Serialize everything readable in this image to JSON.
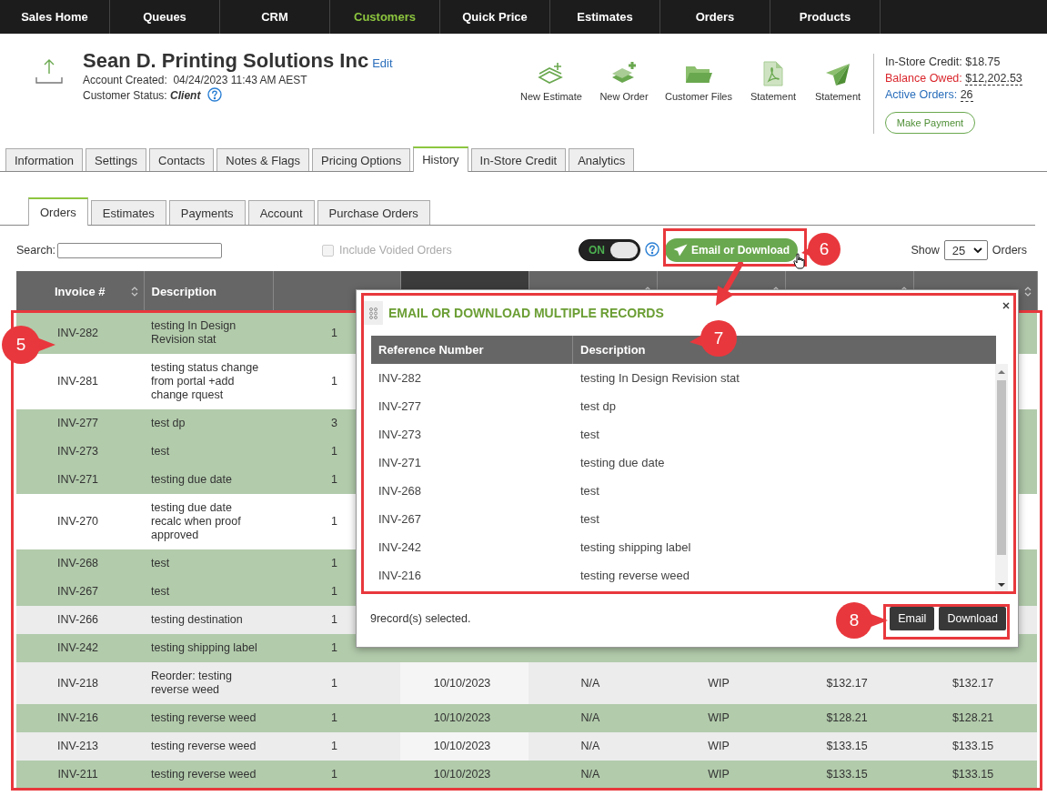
{
  "nav": [
    {
      "label": "Sales Home",
      "selected": false
    },
    {
      "label": "Queues",
      "selected": false
    },
    {
      "label": "CRM",
      "selected": false
    },
    {
      "label": "Customers",
      "selected": true
    },
    {
      "label": "Quick Price",
      "selected": false
    },
    {
      "label": "Estimates",
      "selected": false
    },
    {
      "label": "Orders",
      "selected": false
    },
    {
      "label": "Products",
      "selected": false
    }
  ],
  "customer": {
    "name": "Sean D. Printing Solutions Inc",
    "edit_link": "Edit",
    "created_label": "Account Created:",
    "created_value": "04/24/2023 11:43 AM AEST",
    "status_label": "Customer Status:",
    "status_value": "Client"
  },
  "actions": [
    {
      "label": "New Estimate",
      "kind": "estimate"
    },
    {
      "label": "New Order",
      "kind": "order"
    },
    {
      "label": "Customer Files",
      "kind": "files"
    },
    {
      "label": "Statement",
      "kind": "pdf"
    },
    {
      "label": "Statement",
      "kind": "send"
    }
  ],
  "account_summary": {
    "credit_label": "In-Store Credit:",
    "credit_value": "$18.75",
    "balance_label": "Balance Owed:",
    "balance_value": "$12,202.53",
    "active_label": "Active Orders:",
    "active_value": "26",
    "payment_button": "Make Payment"
  },
  "tabs": [
    {
      "label": "Information",
      "selected": false
    },
    {
      "label": "Settings",
      "selected": false
    },
    {
      "label": "Contacts",
      "selected": false
    },
    {
      "label": "Notes & Flags",
      "selected": false
    },
    {
      "label": "Pricing Options",
      "selected": false
    },
    {
      "label": "History",
      "selected": true
    },
    {
      "label": "In-Store Credit",
      "selected": false
    },
    {
      "label": "Analytics",
      "selected": false
    }
  ],
  "subtabs": [
    {
      "label": "Orders",
      "selected": true
    },
    {
      "label": "Estimates",
      "selected": false
    },
    {
      "label": "Payments",
      "selected": false
    },
    {
      "label": "Account",
      "selected": false
    },
    {
      "label": "Purchase Orders",
      "selected": false
    }
  ],
  "toolbar": {
    "search_label": "Search:",
    "include_voided": {
      "label": "Include Voided Orders",
      "checked": false,
      "disabled": true
    },
    "toggle": {
      "label": "ON",
      "on": true
    },
    "email_button": "Email or Download",
    "show_label": "Show",
    "page_size": "25",
    "orders_label": "Orders"
  },
  "table": {
    "columns": [
      {
        "label": "Invoice #",
        "sortable": true,
        "sorted": false
      },
      {
        "label": "Description",
        "sortable": false,
        "sorted": false
      },
      {
        "sortable": false,
        "sorted": false
      },
      {
        "sortable": false,
        "sorted": true
      },
      {
        "sortable": true,
        "sorted": false
      },
      {
        "sortable": true,
        "sorted": false
      },
      {
        "sortable": true,
        "sorted": false
      },
      {
        "sortable": true,
        "sorted": false
      }
    ],
    "rows": [
      {
        "cells": [
          "INV-282",
          "testing In Design Revision stat",
          "1"
        ],
        "selected": true
      },
      {
        "cells": [
          "INV-281",
          "testing status change from portal +add change rquest",
          "1"
        ],
        "selected": false
      },
      {
        "cells": [
          "INV-277",
          "test dp",
          "3"
        ],
        "selected": true
      },
      {
        "cells": [
          "INV-273",
          "test",
          "1"
        ],
        "selected": true
      },
      {
        "cells": [
          "INV-271",
          "testing due date",
          "1"
        ],
        "selected": true
      },
      {
        "cells": [
          "INV-270",
          "testing due date recalc when proof approved",
          "1"
        ],
        "selected": false
      },
      {
        "cells": [
          "INV-268",
          "test",
          "1"
        ],
        "selected": true
      },
      {
        "cells": [
          "INV-267",
          "test",
          "1"
        ],
        "selected": true
      },
      {
        "cells": [
          "INV-266",
          "testing destination",
          "1"
        ],
        "selected": false
      },
      {
        "cells": [
          "INV-242",
          "testing shipping label",
          "1"
        ],
        "selected": true
      },
      {
        "cells": [
          "INV-218",
          "Reorder: testing reverse weed",
          "1",
          "10/10/2023",
          "N/A",
          "WIP",
          "$132.17",
          "$132.17"
        ],
        "selected": false
      },
      {
        "cells": [
          "INV-216",
          "testing reverse weed",
          "1",
          "10/10/2023",
          "N/A",
          "WIP",
          "$128.21",
          "$128.21"
        ],
        "selected": true
      },
      {
        "cells": [
          "INV-213",
          "testing reverse weed",
          "1",
          "10/10/2023",
          "N/A",
          "WIP",
          "$133.15",
          "$133.15"
        ],
        "selected": false
      },
      {
        "cells": [
          "INV-211",
          "testing reverse weed",
          "1",
          "10/10/2023",
          "N/A",
          "WIP",
          "$133.15",
          "$133.15"
        ],
        "selected": true
      }
    ]
  },
  "dialog": {
    "title": "EMAIL OR DOWNLOAD MULTIPLE RECORDS",
    "columns": [
      "Reference Number",
      "Description"
    ],
    "rows": [
      [
        "INV-282",
        "testing In Design Revision stat"
      ],
      [
        "INV-277",
        "test dp"
      ],
      [
        "INV-273",
        "test"
      ],
      [
        "INV-271",
        "testing due date"
      ],
      [
        "INV-268",
        "test"
      ],
      [
        "INV-267",
        "test"
      ],
      [
        "INV-242",
        "testing shipping label"
      ],
      [
        "INV-216",
        "testing reverse weed"
      ]
    ],
    "footer": "9record(s) selected.",
    "buttons": [
      "Email",
      "Download"
    ]
  },
  "callouts": [
    {
      "number": "5"
    },
    {
      "number": "6"
    },
    {
      "number": "7"
    },
    {
      "number": "8"
    }
  ]
}
